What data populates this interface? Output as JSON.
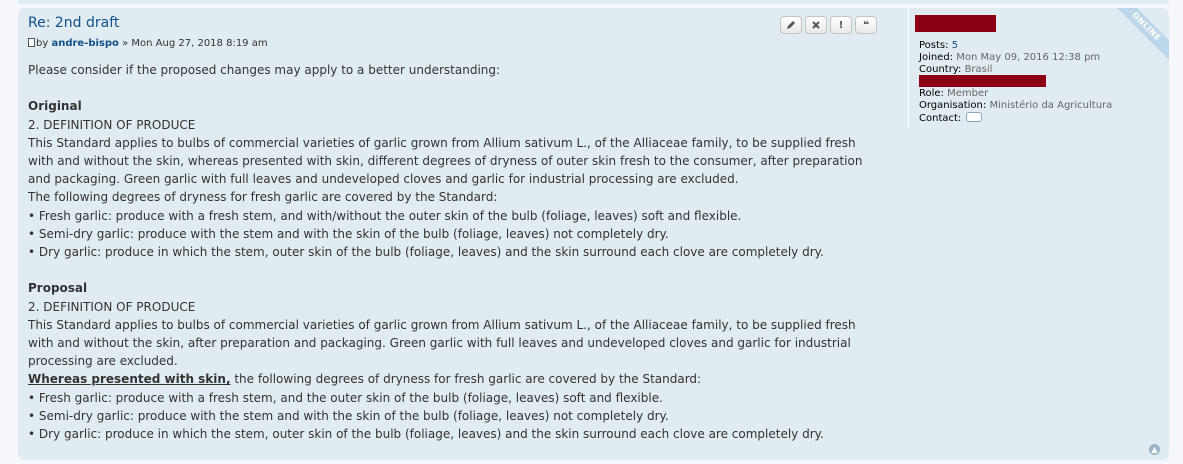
{
  "post": {
    "title": "Re: 2nd draft",
    "by_prefix": "by",
    "author": "andre-bispo",
    "date": "» Mon Aug 27, 2018 8:19 am"
  },
  "actions": {
    "edit_icon": "pencil-icon",
    "delete_icon": "close-icon",
    "report_icon": "exclamation-icon",
    "quote_icon": "quote-icon"
  },
  "content": {
    "intro": "Please consider if the proposed changes may apply to a better understanding:",
    "original_heading": "Original",
    "original_section": "2. DEFINITION OF PRODUCE",
    "original_p1": "This Standard applies to bulbs of commercial varieties of garlic grown from Allium sativum L., of the Alliaceae family, to be supplied fresh with and without the skin, whereas presented with skin, different degrees of dryness of outer skin fresh to the consumer, after preparation and packaging. Green garlic with full leaves and undeveloped cloves and garlic for industrial processing are excluded.",
    "original_p2": "The following degrees of dryness for fresh garlic are covered by the Standard:",
    "original_bullets": [
      "• Fresh garlic: produce with a fresh stem, and with/without the outer skin of the bulb (foliage, leaves) soft and flexible.",
      "• Semi-dry garlic: produce with the stem and with the skin of the bulb (foliage, leaves) not completely dry.",
      "• Dry garlic: produce in which the stem, outer skin of the bulb (foliage, leaves) and the skin surround each clove are completely dry."
    ],
    "proposal_heading": "Proposal",
    "proposal_section": "2. DEFINITION OF PRODUCE",
    "proposal_p1": "This Standard applies to bulbs of commercial varieties of garlic grown from Allium sativum L., of the Alliaceae family, to be supplied fresh with and without the skin, after preparation and packaging. Green garlic with full leaves and undeveloped cloves and garlic for industrial processing are excluded.",
    "proposal_p2_underlined": "Whereas presented with skin,",
    "proposal_p2_rest": " the following degrees of dryness for fresh garlic are covered by the Standard:",
    "proposal_bullets": [
      "• Fresh garlic: produce with a fresh stem, and the outer skin of the bulb (foliage, leaves) soft and flexible.",
      "• Semi-dry garlic: produce with the stem and with the skin of the bulb (foliage, leaves) not completely dry.",
      "• Dry garlic: produce in which the stem, outer skin of the bulb (foliage, leaves) and the skin surround each clove are completely dry."
    ]
  },
  "profile": {
    "posts_label": "Posts:",
    "posts_value": "5",
    "joined_label": "Joined:",
    "joined_value": "Mon May 09, 2016 12:38 pm",
    "country_label": "Country:",
    "country_value": "Brasil",
    "role_label": "Role:",
    "role_value": "Member",
    "org_label": "Organisation:",
    "org_value": "Ministério da Agricultura",
    "contact_label": "Contact:",
    "online_badge": "ONLINE",
    "redaction_color": "#8b0015"
  },
  "top_icon": "back-to-top-icon"
}
